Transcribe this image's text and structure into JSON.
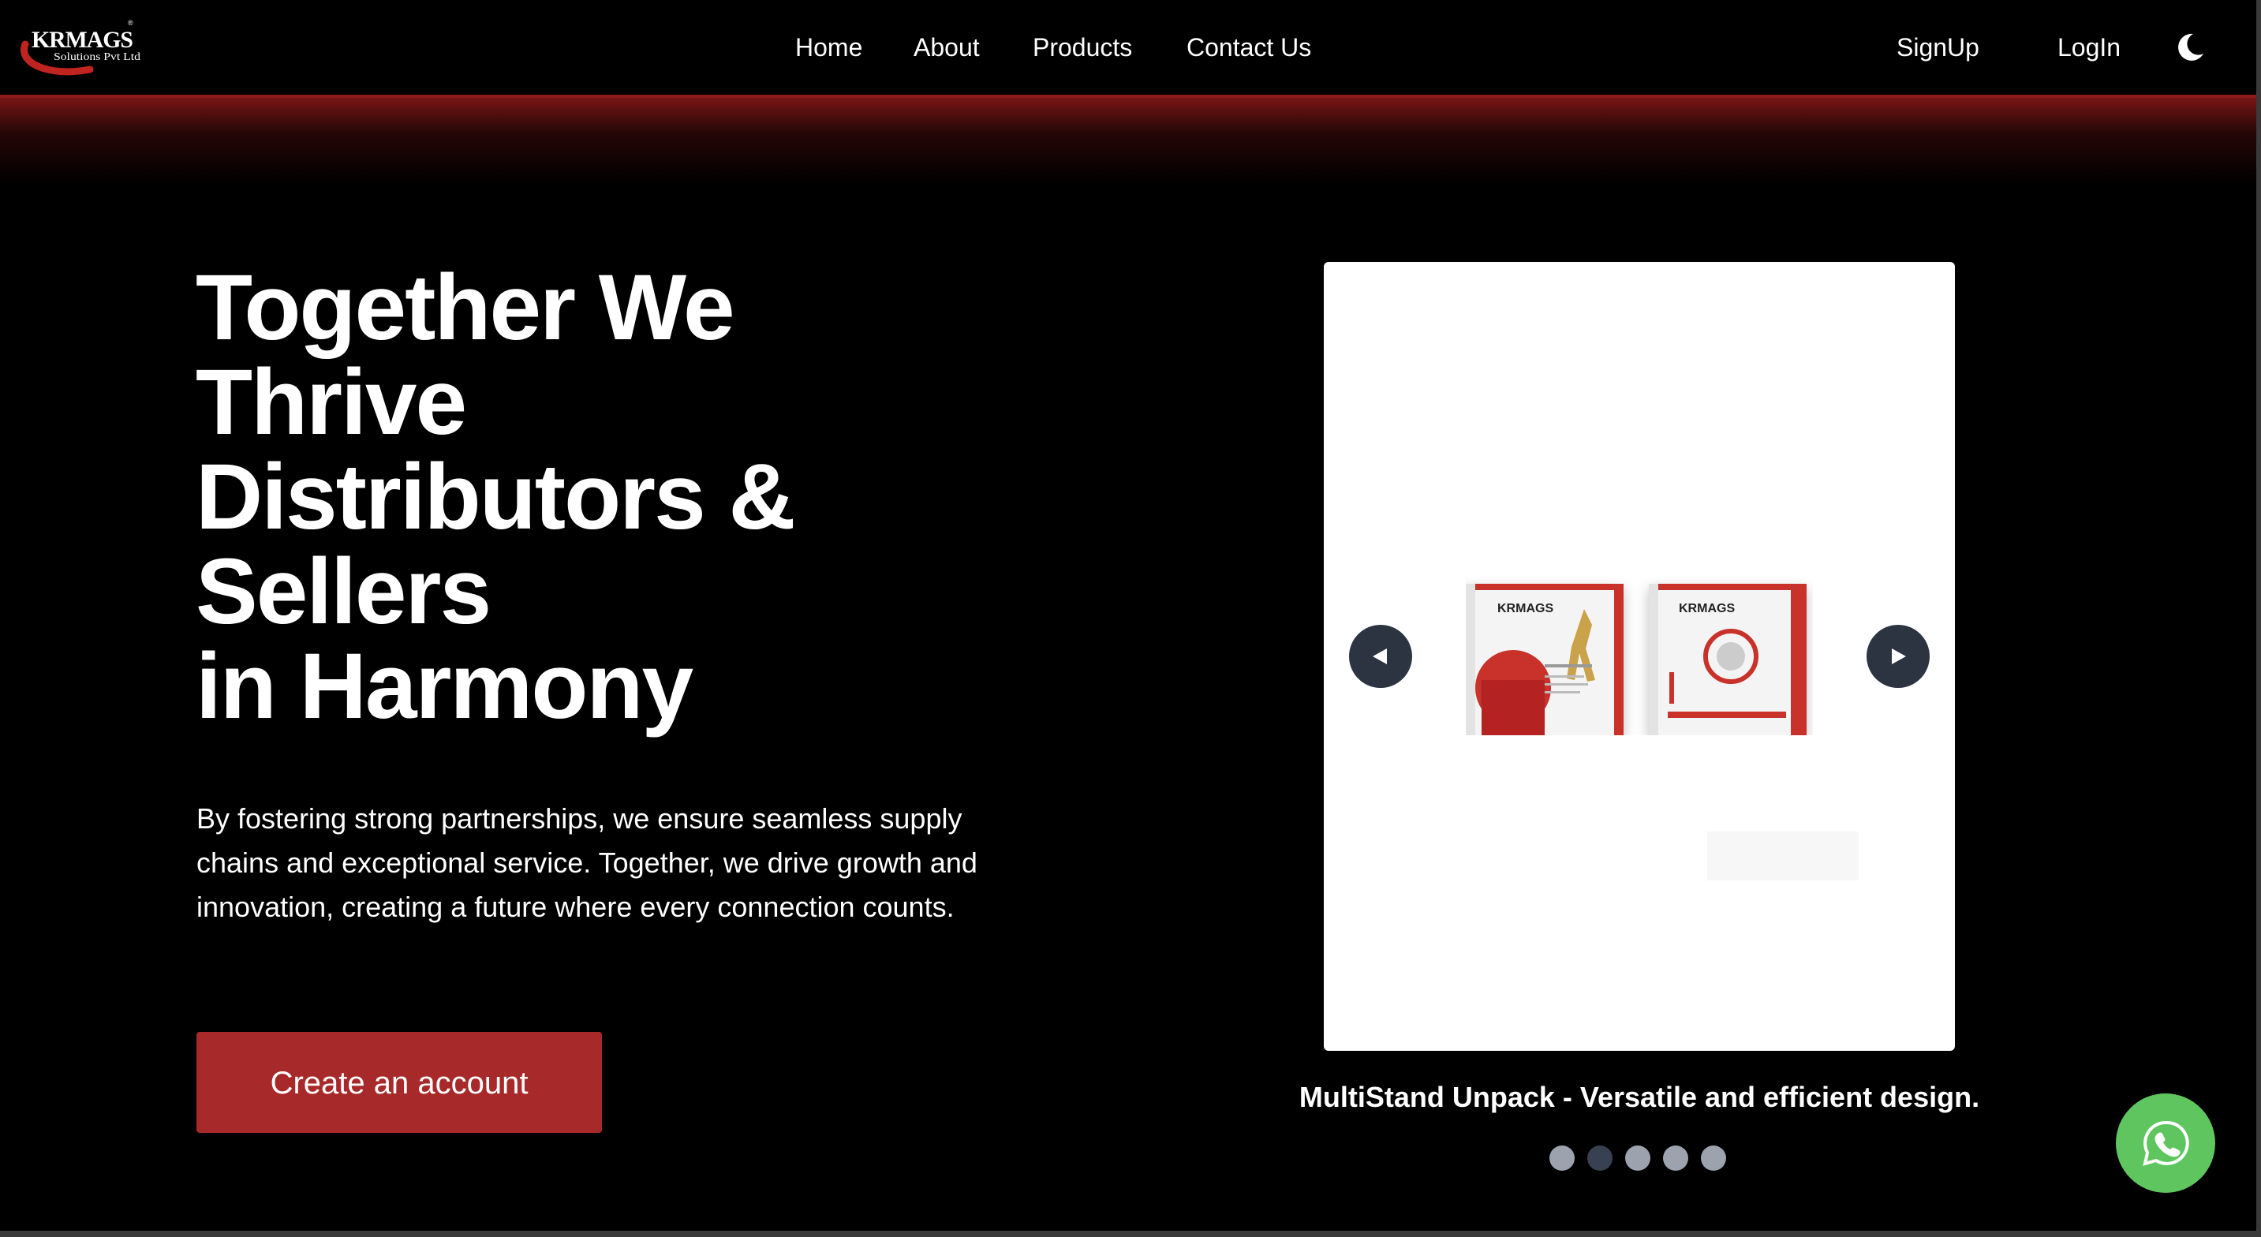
{
  "brand": {
    "logo_name": "KRMAGS",
    "logo_sub": "Solutions Pvt Ltd",
    "logo_mark": "®",
    "accent_color": "#a8292a"
  },
  "nav": {
    "links": [
      "Home",
      "About",
      "Products",
      "Contact Us"
    ],
    "signup": "SignUp",
    "login": "LogIn",
    "theme_icon": "moon-icon"
  },
  "hero": {
    "title_lines": [
      "Together We",
      "Thrive",
      "Distributors &",
      "Sellers",
      "in Harmony"
    ],
    "description": "By fostering strong partnerships, we ensure seamless supply chains and exceptional service. Together, we drive growth and innovation, creating a future where every connection counts.",
    "cta": "Create an account"
  },
  "carousel": {
    "caption": "MultiStand Unpack - Versatile and efficient design.",
    "slide_count": 5,
    "active_index": 1,
    "prev_icon": "triangle-left-icon",
    "next_icon": "triangle-right-icon",
    "box_brand": "KRMAGS"
  },
  "floating": {
    "whatsapp_icon": "whatsapp-icon",
    "color": "#5fc65f"
  }
}
